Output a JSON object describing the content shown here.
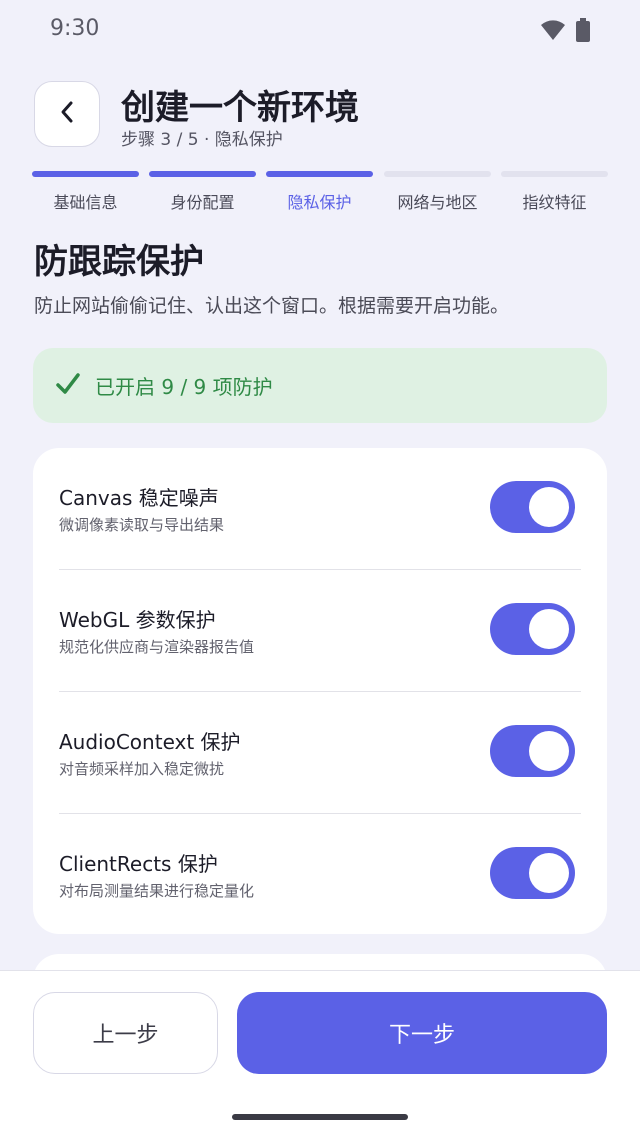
{
  "status_bar": {
    "time": "9:30",
    "icons": [
      "wifi-icon",
      "battery-icon"
    ]
  },
  "header": {
    "back_icon": "chevron-left-icon",
    "title": "创建一个新环境",
    "subtitle": "步骤 3 / 5 · 隐私保护"
  },
  "stepper": {
    "steps": [
      {
        "label": "基础信息",
        "state": "done"
      },
      {
        "label": "身份配置",
        "state": "done"
      },
      {
        "label": "隐私保护",
        "state": "current"
      },
      {
        "label": "网络与地区",
        "state": "pending"
      },
      {
        "label": "指纹特征",
        "state": "pending"
      }
    ]
  },
  "section": {
    "title": "防跟踪保护",
    "description": "防止网站偷偷记住、认出这个窗口。根据需要开启功能。"
  },
  "banner": {
    "icon": "checkmark-icon",
    "text": "已开启 9 / 9 项防护"
  },
  "protections": [
    {
      "title": "Canvas 稳定噪声",
      "subtitle": "微调像素读取与导出结果",
      "enabled": true
    },
    {
      "title": "WebGL 参数保护",
      "subtitle": "规范化供应商与渲染器报告值",
      "enabled": true
    },
    {
      "title": "AudioContext 保护",
      "subtitle": "对音频采样加入稳定微扰",
      "enabled": true
    },
    {
      "title": "ClientRects 保护",
      "subtitle": "对布局测量结果进行稳定量化",
      "enabled": true
    }
  ],
  "footer": {
    "prev_label": "上一步",
    "next_label": "下一步"
  },
  "colors": {
    "accent": "#5b61e6",
    "background": "#f1f1fa",
    "success_bg": "#dff1e3",
    "success_text": "#2f8a46"
  }
}
